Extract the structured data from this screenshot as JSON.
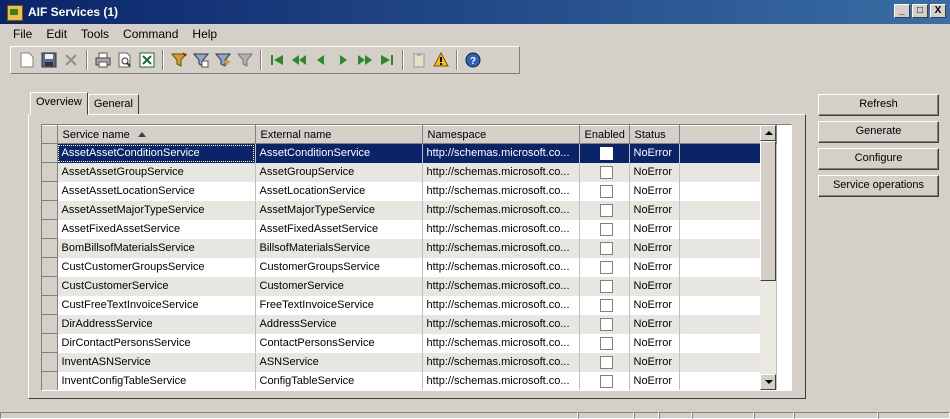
{
  "window": {
    "title": "AIF Services (1)"
  },
  "title_buttons": [
    "_",
    "□",
    "X"
  ],
  "menu": [
    "File",
    "Edit",
    "Tools",
    "Command",
    "Help"
  ],
  "toolbar_icons": [
    "new-document-icon",
    "save-icon",
    "delete-icon",
    "print-icon",
    "print-preview-icon",
    "export-excel-icon",
    "filter-by-selection-icon",
    "filter-by-grid-icon",
    "advanced-filter-icon",
    "remove-filter-icon",
    "first-record-icon",
    "previous-page-icon",
    "previous-record-icon",
    "next-record-icon",
    "next-page-icon",
    "last-record-icon",
    "document-handling-icon",
    "alert-icon",
    "help-icon"
  ],
  "tabs": [
    "Overview",
    "General"
  ],
  "grid": {
    "columns": [
      "Service name",
      "External name",
      "Namespace",
      "Enabled",
      "Status"
    ],
    "rows": [
      {
        "service": "AssetAssetConditionService",
        "external": "AssetConditionService",
        "namespace": "http://schemas.microsoft.co...",
        "enabled": false,
        "status": "NoError"
      },
      {
        "service": "AssetAssetGroupService",
        "external": "AssetGroupService",
        "namespace": "http://schemas.microsoft.co...",
        "enabled": false,
        "status": "NoError"
      },
      {
        "service": "AssetAssetLocationService",
        "external": "AssetLocationService",
        "namespace": "http://schemas.microsoft.co...",
        "enabled": false,
        "status": "NoError"
      },
      {
        "service": "AssetAssetMajorTypeService",
        "external": "AssetMajorTypeService",
        "namespace": "http://schemas.microsoft.co...",
        "enabled": false,
        "status": "NoError"
      },
      {
        "service": "AssetFixedAssetService",
        "external": "AssetFixedAssetService",
        "namespace": "http://schemas.microsoft.co...",
        "enabled": false,
        "status": "NoError"
      },
      {
        "service": "BomBillsofMaterialsService",
        "external": "BillsofMaterialsService",
        "namespace": "http://schemas.microsoft.co...",
        "enabled": false,
        "status": "NoError"
      },
      {
        "service": "CustCustomerGroupsService",
        "external": "CustomerGroupsService",
        "namespace": "http://schemas.microsoft.co...",
        "enabled": false,
        "status": "NoError"
      },
      {
        "service": "CustCustomerService",
        "external": "CustomerService",
        "namespace": "http://schemas.microsoft.co...",
        "enabled": false,
        "status": "NoError"
      },
      {
        "service": "CustFreeTextInvoiceService",
        "external": "FreeTextInvoiceService",
        "namespace": "http://schemas.microsoft.co...",
        "enabled": false,
        "status": "NoError"
      },
      {
        "service": "DirAddressService",
        "external": "AddressService",
        "namespace": "http://schemas.microsoft.co...",
        "enabled": false,
        "status": "NoError"
      },
      {
        "service": "DirContactPersonsService",
        "external": "ContactPersonsService",
        "namespace": "http://schemas.microsoft.co...",
        "enabled": false,
        "status": "NoError"
      },
      {
        "service": "InventASNService",
        "external": "ASNService",
        "namespace": "http://schemas.microsoft.co...",
        "enabled": false,
        "status": "NoError"
      },
      {
        "service": "InventConfigTableService",
        "external": "ConfigTableService",
        "namespace": "http://schemas.microsoft.co...",
        "enabled": false,
        "status": "NoError"
      }
    ]
  },
  "buttons": {
    "refresh": "Refresh",
    "generate": "Generate",
    "configure": "Configure",
    "service_operations": "Service operations"
  },
  "colors": {
    "title_bar": "#0a246a",
    "selection": "#0a246a",
    "face": "#d4d0c8"
  }
}
